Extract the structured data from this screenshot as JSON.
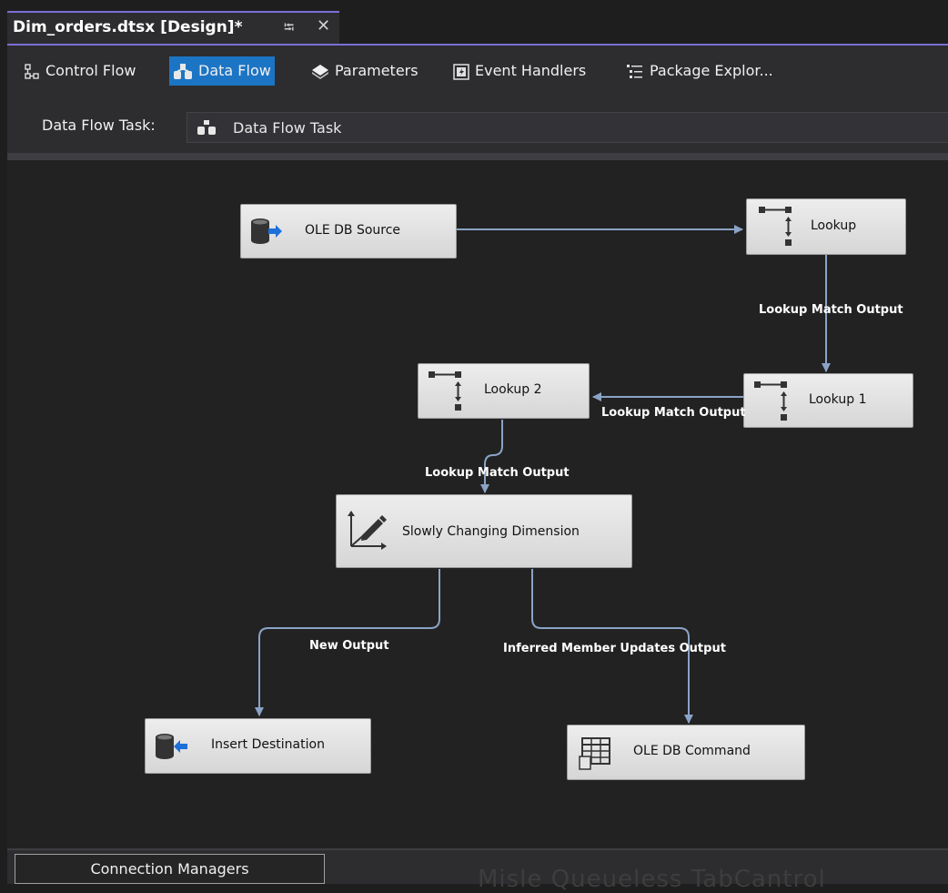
{
  "document_tab": {
    "title": "Dim_orders.dtsx [Design]*",
    "pin_glyph": "⭾",
    "close_glyph": "✕"
  },
  "toolbar": {
    "control_flow": "Control Flow",
    "data_flow": "Data Flow",
    "parameters": "Parameters",
    "event_handlers": "Event Handlers",
    "package_explorer": "Package Explor..."
  },
  "task_selector": {
    "label": "Data Flow Task:",
    "value": "Data Flow Task"
  },
  "components": {
    "ole_db_source": "OLE DB Source",
    "lookup": "Lookup",
    "lookup_1": "Lookup 1",
    "lookup_2": "Lookup 2",
    "scd": "Slowly Changing Dimension",
    "insert_destination": "Insert Destination",
    "ole_db_command": "OLE DB Command"
  },
  "paths": {
    "lookup_to_lookup1": "Lookup Match Output",
    "lookup1_to_lookup2": "Lookup Match Output",
    "lookup2_to_scd": "Lookup Match Output",
    "scd_new": "New Output",
    "scd_inferred": "Inferred Member Updates Output"
  },
  "bottom": {
    "connection_managers": "Connection Managers",
    "ghost_text": "Misle Queueless TabCantrol"
  },
  "colors": {
    "accent": "#7a6fd6",
    "active_tab": "#1c75c4",
    "arrow": "#8aa3c6",
    "canvas": "#222222"
  }
}
